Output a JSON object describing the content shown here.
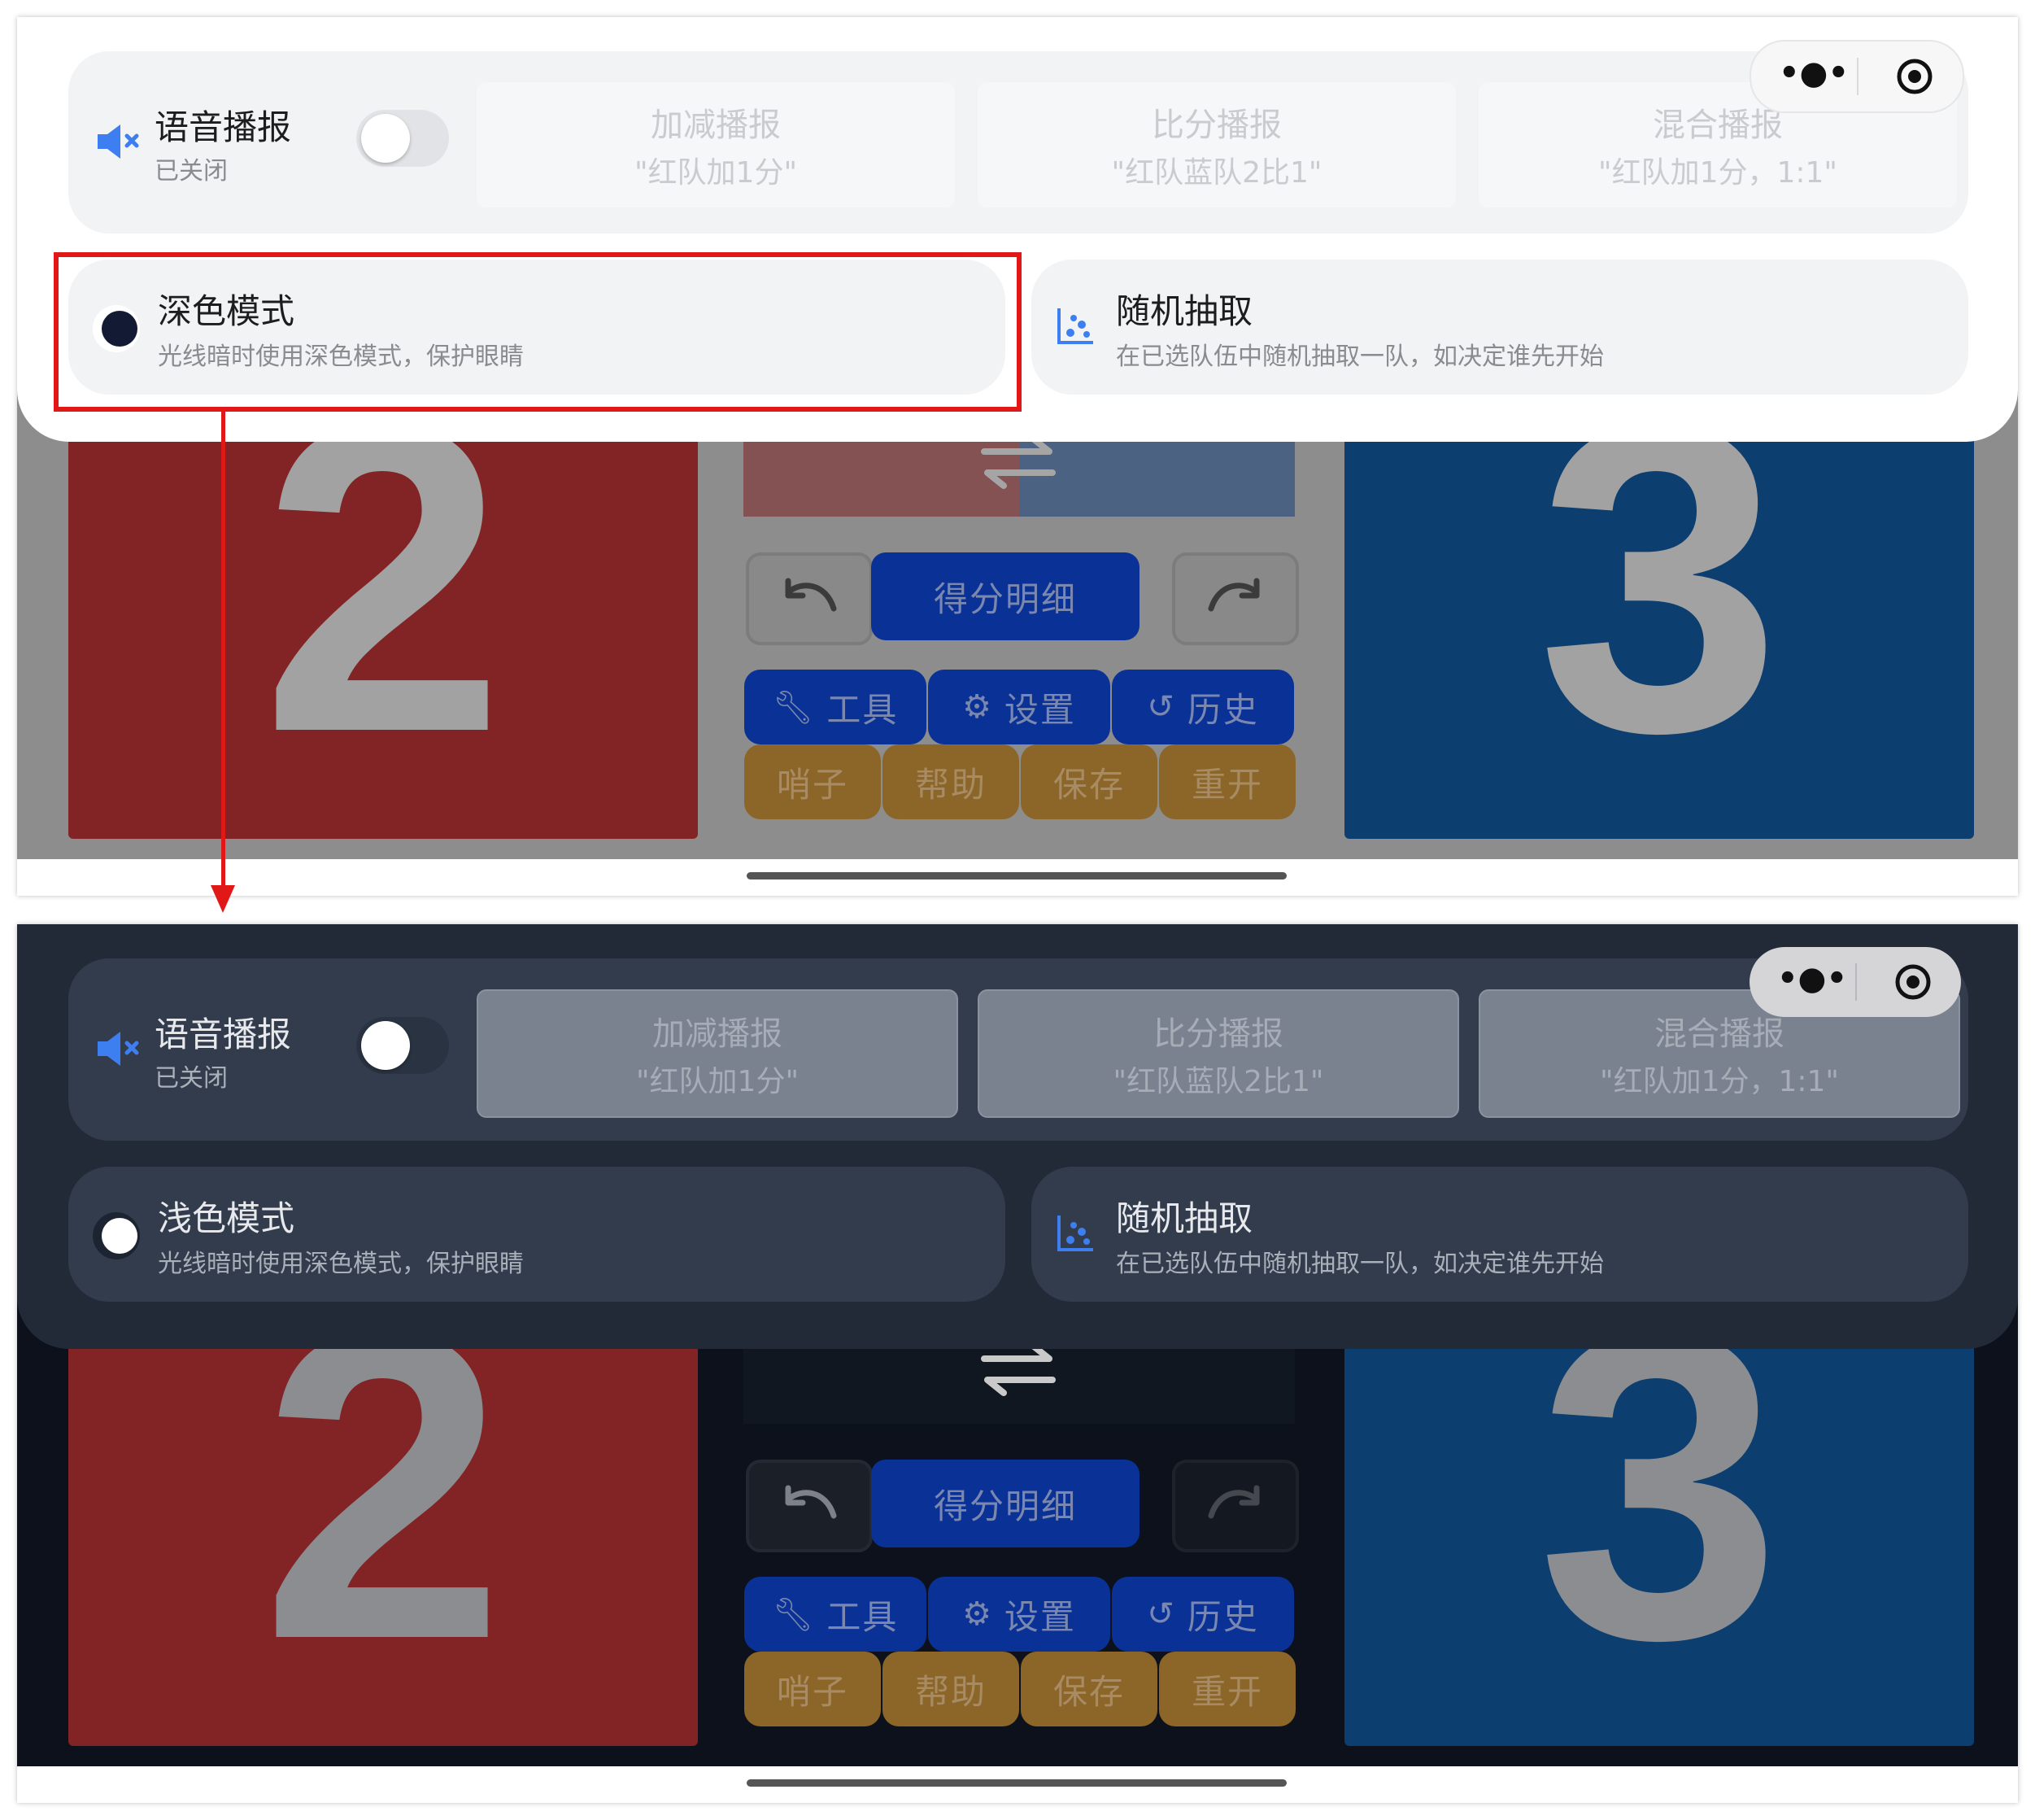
{
  "light": {
    "voice": {
      "title": "语音播报",
      "status": "已关闭"
    },
    "options": [
      {
        "title": "加减播报",
        "example": "\"红队加1分\""
      },
      {
        "title": "比分播报",
        "example": "\"红队蓝队2比1\""
      },
      {
        "title": "混合播报",
        "example": "\"红队加1分，1:1\""
      }
    ],
    "theme": {
      "title": "深色模式",
      "desc": "光线暗时使用深色模式，保护眼睛"
    },
    "random": {
      "title": "随机抽取",
      "desc": "在已选队伍中随机抽取一队，如决定谁先开始"
    }
  },
  "dark": {
    "voice": {
      "title": "语音播报",
      "status": "已关闭"
    },
    "options": [
      {
        "title": "加减播报",
        "example": "\"红队加1分\""
      },
      {
        "title": "比分播报",
        "example": "\"红队蓝队2比1\""
      },
      {
        "title": "混合播报",
        "example": "\"红队加1分，1:1\""
      }
    ],
    "theme": {
      "title": "浅色模式",
      "desc": "光线暗时使用深色模式，保护眼睛"
    },
    "random": {
      "title": "随机抽取",
      "desc": "在已选队伍中随机抽取一队，如决定谁先开始"
    }
  },
  "scoreboard": {
    "red_score": "2",
    "blue_score": "3",
    "detail_label": "得分明细",
    "tools_label": "工具",
    "settings_label": "设置",
    "history_label": "历史",
    "whistle_label": "哨子",
    "help_label": "帮助",
    "save_label": "保存",
    "restart_label": "重开"
  },
  "colors": {
    "highlight": "#e01818",
    "red_team": "#822426",
    "blue_team": "#0c3e6f",
    "primary_button": "#0a3196",
    "secondary_button": "#8c6628"
  }
}
